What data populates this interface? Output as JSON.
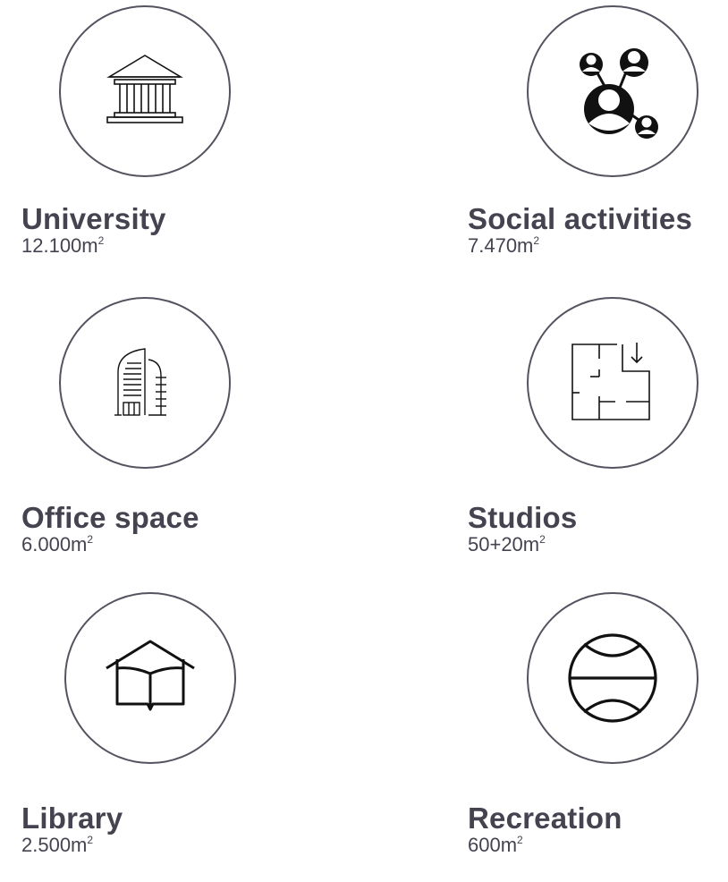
{
  "items": [
    {
      "key": "university",
      "title": "University",
      "area": "12.100m",
      "unit_sup": "2",
      "icon": "university-building-icon"
    },
    {
      "key": "social",
      "title": "Social activities",
      "area": "7.470m",
      "unit_sup": "2",
      "icon": "social-network-icon"
    },
    {
      "key": "office",
      "title": "Office space",
      "area": "6.000m",
      "unit_sup": "2",
      "icon": "office-building-icon"
    },
    {
      "key": "studios",
      "title": "Studios",
      "area": "50+20m",
      "unit_sup": "2",
      "icon": "floor-plan-icon"
    },
    {
      "key": "library",
      "title": "Library",
      "area": "2.500m",
      "unit_sup": "2",
      "icon": "library-book-icon"
    },
    {
      "key": "recreation",
      "title": "Recreation",
      "area": "600m",
      "unit_sup": "2",
      "icon": "recreation-ball-icon"
    }
  ],
  "colors": {
    "text": "#45434f",
    "circle_border": "#55535f",
    "icon": "#111111"
  }
}
